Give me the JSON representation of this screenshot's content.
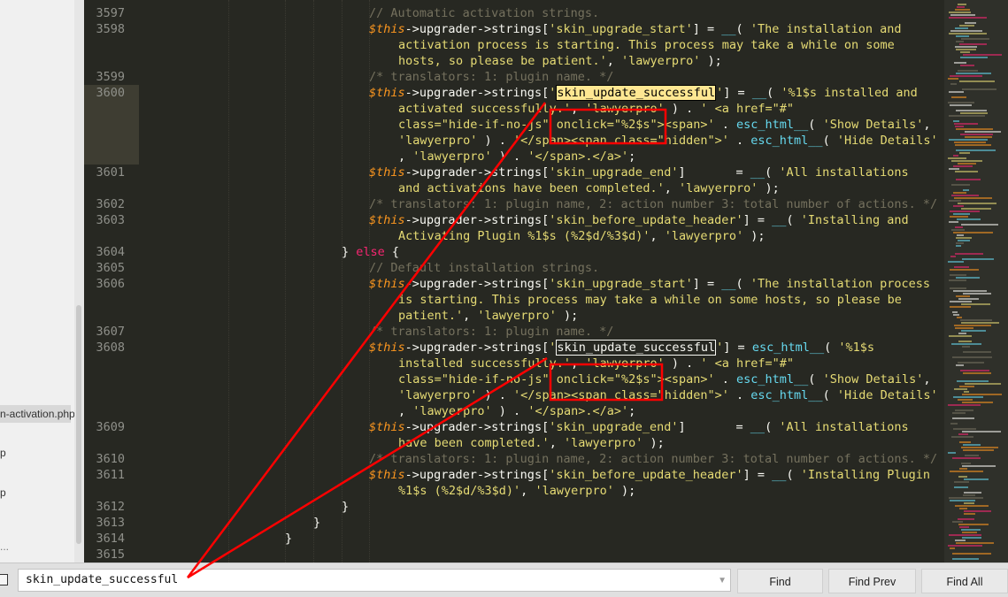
{
  "sidebar": {
    "files": [
      {
        "label": "n-activation.php",
        "active": true
      },
      {
        "label": "p"
      },
      {
        "label": "p"
      },
      {
        "label": "..."
      }
    ]
  },
  "editor": {
    "lines": [
      {
        "num": "3597",
        "segs": [
          [
            "c",
            "// Automatic activation strings."
          ]
        ]
      },
      {
        "num": "3598",
        "segs": [
          [
            "v",
            "$this"
          ],
          [
            "p",
            "->upgrader->strings["
          ],
          [
            "s",
            "'skin_upgrade_start'"
          ],
          [
            "p",
            "] = "
          ],
          [
            "f",
            "__"
          ],
          [
            "p",
            "( "
          ],
          [
            "s",
            "'The installation and"
          ]
        ]
      },
      {
        "num": "",
        "segs": [
          [
            "s",
            "activation process is starting. This process may take a while on some"
          ]
        ]
      },
      {
        "num": "",
        "segs": [
          [
            "s",
            "hosts, so please be patient.'"
          ],
          [
            "p",
            ", "
          ],
          [
            "s",
            "'lawyerpro'"
          ],
          [
            "p",
            " );"
          ]
        ]
      },
      {
        "num": "3599",
        "segs": [
          [
            "c",
            "/* translators: 1: plugin name. */"
          ]
        ]
      },
      {
        "num": "3600",
        "segs": [
          [
            "v",
            "$this"
          ],
          [
            "p",
            "->upgrader->strings["
          ],
          [
            "s",
            "'"
          ],
          [
            "m1",
            "skin_update_successful"
          ],
          [
            "s",
            "'"
          ],
          [
            "p",
            "] = "
          ],
          [
            "f",
            "__"
          ],
          [
            "p",
            "( "
          ],
          [
            "s",
            "'%1$s installed and"
          ]
        ]
      },
      {
        "num": "",
        "segs": [
          [
            "s",
            "activated successfully.'"
          ],
          [
            "p",
            ", "
          ],
          [
            "s",
            "'lawyerpro'"
          ],
          [
            "p",
            " ) . "
          ],
          [
            "s",
            "' <a href=\"#\""
          ]
        ]
      },
      {
        "num": "",
        "segs": [
          [
            "s",
            "class=\"hide-if-no-js\" onclick=\"%2$s\"><span>'"
          ],
          [
            "p",
            " . "
          ],
          [
            "f",
            "esc_html__"
          ],
          [
            "p",
            "( "
          ],
          [
            "s",
            "'Show Details'"
          ],
          [
            "p",
            ","
          ]
        ]
      },
      {
        "num": "",
        "segs": [
          [
            "s",
            "'lawyerpro'"
          ],
          [
            "p",
            " ) . "
          ],
          [
            "s",
            "'</span><span class=\"hidden\">'"
          ],
          [
            "p",
            " . "
          ],
          [
            "f",
            "esc_html__"
          ],
          [
            "p",
            "( "
          ],
          [
            "s",
            "'Hide Details'"
          ]
        ]
      },
      {
        "num": "",
        "segs": [
          [
            "p",
            ", "
          ],
          [
            "s",
            "'lawyerpro'"
          ],
          [
            "p",
            " ) . "
          ],
          [
            "s",
            "'</span>.</a>'"
          ],
          [
            "p",
            ";"
          ]
        ]
      },
      {
        "num": "3601",
        "segs": [
          [
            "v",
            "$this"
          ],
          [
            "p",
            "->upgrader->strings["
          ],
          [
            "s",
            "'skin_upgrade_end'"
          ],
          [
            "p",
            "]       = "
          ],
          [
            "f",
            "__"
          ],
          [
            "p",
            "( "
          ],
          [
            "s",
            "'All installations"
          ]
        ]
      },
      {
        "num": "",
        "segs": [
          [
            "s",
            "and activations have been completed.'"
          ],
          [
            "p",
            ", "
          ],
          [
            "s",
            "'lawyerpro'"
          ],
          [
            "p",
            " );"
          ]
        ]
      },
      {
        "num": "3602",
        "segs": [
          [
            "c",
            "/* translators: 1: plugin name, 2: action number 3: total number of actions. */"
          ]
        ]
      },
      {
        "num": "3603",
        "segs": [
          [
            "v",
            "$this"
          ],
          [
            "p",
            "->upgrader->strings["
          ],
          [
            "s",
            "'skin_before_update_header'"
          ],
          [
            "p",
            "] = "
          ],
          [
            "f",
            "__"
          ],
          [
            "p",
            "( "
          ],
          [
            "s",
            "'Installing and"
          ]
        ]
      },
      {
        "num": "",
        "segs": [
          [
            "s",
            "Activating Plugin %1$s (%2$d/%3$d)'"
          ],
          [
            "p",
            ", "
          ],
          [
            "s",
            "'lawyerpro'"
          ],
          [
            "p",
            " );"
          ]
        ]
      },
      {
        "num": "3604",
        "segs": [
          [
            "p",
            "} "
          ],
          [
            "k",
            "else"
          ],
          [
            "p",
            " {"
          ]
        ]
      },
      {
        "num": "3605",
        "segs": [
          [
            "c",
            "// Default installation strings."
          ]
        ]
      },
      {
        "num": "3606",
        "segs": [
          [
            "v",
            "$this"
          ],
          [
            "p",
            "->upgrader->strings["
          ],
          [
            "s",
            "'skin_upgrade_start'"
          ],
          [
            "p",
            "] = "
          ],
          [
            "f",
            "__"
          ],
          [
            "p",
            "( "
          ],
          [
            "s",
            "'The installation process"
          ]
        ]
      },
      {
        "num": "",
        "segs": [
          [
            "s",
            "is starting. This process may take a while on some hosts, so please be"
          ]
        ]
      },
      {
        "num": "",
        "segs": [
          [
            "s",
            "patient.'"
          ],
          [
            "p",
            ", "
          ],
          [
            "s",
            "'lawyerpro'"
          ],
          [
            "p",
            " );"
          ]
        ]
      },
      {
        "num": "3607",
        "segs": [
          [
            "c",
            "/* translators: 1: plugin name. */"
          ]
        ]
      },
      {
        "num": "3608",
        "segs": [
          [
            "v",
            "$this"
          ],
          [
            "p",
            "->upgrader->strings["
          ],
          [
            "s",
            "'"
          ],
          [
            "m2",
            "skin_update_successful"
          ],
          [
            "s",
            "'"
          ],
          [
            "p",
            "] = "
          ],
          [
            "f",
            "esc_html__"
          ],
          [
            "p",
            "( "
          ],
          [
            "s",
            "'%1$s"
          ]
        ]
      },
      {
        "num": "",
        "segs": [
          [
            "s",
            "installed successfully.'"
          ],
          [
            "p",
            ", "
          ],
          [
            "s",
            "'lawyerpro'"
          ],
          [
            "p",
            " ) . "
          ],
          [
            "s",
            "' <a href=\"#\""
          ]
        ]
      },
      {
        "num": "",
        "segs": [
          [
            "s",
            "class=\"hide-if-no-js\" onclick=\"%2$s\"><span>'"
          ],
          [
            "p",
            " . "
          ],
          [
            "f",
            "esc_html__"
          ],
          [
            "p",
            "( "
          ],
          [
            "s",
            "'Show Details'"
          ],
          [
            "p",
            ","
          ]
        ]
      },
      {
        "num": "",
        "segs": [
          [
            "s",
            "'lawyerpro'"
          ],
          [
            "p",
            " ) . "
          ],
          [
            "s",
            "'</span><span class=\"hidden\">'"
          ],
          [
            "p",
            " . "
          ],
          [
            "f",
            "esc_html__"
          ],
          [
            "p",
            "( "
          ],
          [
            "s",
            "'Hide Details'"
          ]
        ]
      },
      {
        "num": "",
        "segs": [
          [
            "p",
            ", "
          ],
          [
            "s",
            "'lawyerpro'"
          ],
          [
            "p",
            " ) . "
          ],
          [
            "s",
            "'</span>.</a>'"
          ],
          [
            "p",
            ";"
          ]
        ]
      },
      {
        "num": "3609",
        "segs": [
          [
            "v",
            "$this"
          ],
          [
            "p",
            "->upgrader->strings["
          ],
          [
            "s",
            "'skin_upgrade_end'"
          ],
          [
            "p",
            "]       = "
          ],
          [
            "f",
            "__"
          ],
          [
            "p",
            "( "
          ],
          [
            "s",
            "'All installations"
          ]
        ]
      },
      {
        "num": "",
        "segs": [
          [
            "s",
            "have been completed.'"
          ],
          [
            "p",
            ", "
          ],
          [
            "s",
            "'lawyerpro'"
          ],
          [
            "p",
            " );"
          ]
        ]
      },
      {
        "num": "3610",
        "segs": [
          [
            "c",
            "/* translators: 1: plugin name, 2: action number 3: total number of actions. */"
          ]
        ]
      },
      {
        "num": "3611",
        "segs": [
          [
            "v",
            "$this"
          ],
          [
            "p",
            "->upgrader->strings["
          ],
          [
            "s",
            "'skin_before_update_header'"
          ],
          [
            "p",
            "] = "
          ],
          [
            "f",
            "__"
          ],
          [
            "p",
            "( "
          ],
          [
            "s",
            "'Installing Plugin"
          ]
        ]
      },
      {
        "num": "",
        "segs": [
          [
            "s",
            "%1$s (%2$d/%3$d)'"
          ],
          [
            "p",
            ", "
          ],
          [
            "s",
            "'lawyerpro'"
          ],
          [
            "p",
            " );"
          ]
        ]
      },
      {
        "num": "3612",
        "segs": [
          [
            "p",
            "}"
          ]
        ]
      },
      {
        "num": "3613",
        "segs": [
          [
            "p",
            "}"
          ]
        ]
      },
      {
        "num": "3614",
        "segs": [
          [
            "p",
            "}"
          ]
        ]
      },
      {
        "num": "3615",
        "segs": []
      }
    ]
  },
  "findbar": {
    "query": "skin_update_successful",
    "find_label": "Find",
    "find_prev_label": "Find Prev",
    "find_all_label": "Find All"
  },
  "colors": {
    "background": "#272822",
    "string": "#e6db74",
    "comment": "#75715e",
    "keyword": "#f92672",
    "function": "#66d9ef",
    "variable": "#fd971f",
    "annotation": "#ff0000"
  }
}
